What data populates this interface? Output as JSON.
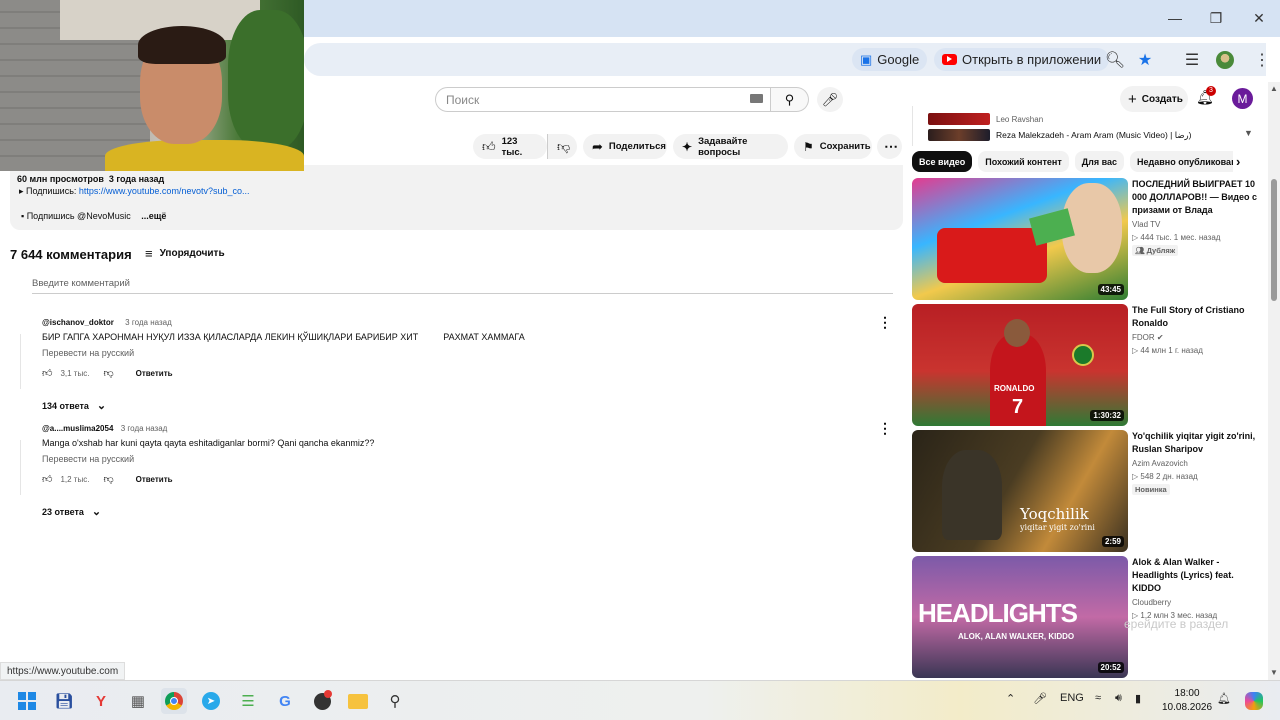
{
  "browser": {
    "omnibox_chips": {
      "google": "Google",
      "open_in_app": "Открыть в приложении"
    }
  },
  "yt_header": {
    "search_placeholder": "Поиск",
    "create_label": "Создать",
    "notification_count": "3",
    "avatar_letter": "M"
  },
  "video_actions": {
    "likes": "123 тыс.",
    "share": "Поделиться",
    "ask": "Задавайте вопросы",
    "save": "Сохранить"
  },
  "description": {
    "stats": "60 млн просмотров  3 года назад",
    "subscribe_line_prefix": "▸ Подпишись: ",
    "subscribe_link": "https://www.youtube.com/nevotv?sub_co...",
    "subscribe_line2_prefix": "▪  Подпишись @NevoMusic",
    "more": "...ещё"
  },
  "comments": {
    "count_title": "7 644 комментария",
    "sort_label": "Упорядочить",
    "input_placeholder": "Введите комментарий",
    "items": [
      {
        "author": "@ischanov_doktor",
        "time": "3 года назад",
        "text": "БИР ГАПГА ХАРОНМАН НУҚУЛ ИЗЗА ҚИЛАСЛАРДА ЛЕКИН ҚЎШИҚЛАРИ БАРИБИР ХИТ          РАХМАТ ХАММАГА",
        "translate": "Перевести на русский",
        "likes": "3,1 тыс.",
        "reply": "Ответить",
        "replies": "134 ответа"
      },
      {
        "author": "@a....muslima2054",
        "time": "3 года назад",
        "text": "Manga o'xshab har kuni qayta qayta eshitadiganlar bormi? Qani qancha ekanmiz??",
        "translate": "Перевести на русский",
        "likes": "1,2 тыс.",
        "reply": "Ответить",
        "replies": "23 ответа"
      }
    ]
  },
  "playlist": [
    {
      "title": "Leo Ravshan"
    },
    {
      "title": "Reza Malekzadeh - Aram Aram (Music Video) | رضا)"
    }
  ],
  "filter_chips": [
    "Все видео",
    "Похожий контент",
    "Для вас",
    "Недавно опубликованн"
  ],
  "recommendations": [
    {
      "title": "ПОСЛЕДНИЙ ВЫИГРАЕТ 10 000 ДОЛЛАРОВ!! — Видео с призами от Влада",
      "channel": "Vlad TV",
      "meta": "▷ 444 тыс.  1 мес. назад",
      "tag": "Дубляж",
      "duration": "43:45"
    },
    {
      "title": "The Full Story of Cristiano Ronaldo",
      "channel": "FDOR",
      "meta": "▷ 44 млн  1 г. назад",
      "tag": "",
      "duration": "1:30:32",
      "thumb_text": "RONALDO"
    },
    {
      "title": "Yo'qchilik yiqitar yigit zo'rini, Ruslan Sharipov",
      "channel": "Azim Avazovich",
      "meta": "▷ 548  2 дн. назад",
      "tag": "Новинка",
      "duration": "2:59",
      "thumb_text": "Yoqchilik",
      "thumb_subtext": "yiqitar yigit zo'rini"
    },
    {
      "title": "Alok & Alan Walker - Headlights (Lyrics) feat. KIDDO",
      "channel": "Cloudberry",
      "meta": "▷ 1,2 млн  3 мес. назад",
      "tag": "",
      "duration": "20:52",
      "thumb_text": "HEADLIGHTS",
      "thumb_subtext": "ALOK, ALAN WALKER, KIDDO"
    }
  ],
  "status_url": "https://www.youtube.com",
  "overlay_hint": "ерейдите в раздел",
  "taskbar": {
    "lang": "ENG",
    "time": "18:00",
    "date": "10.08.2026"
  }
}
